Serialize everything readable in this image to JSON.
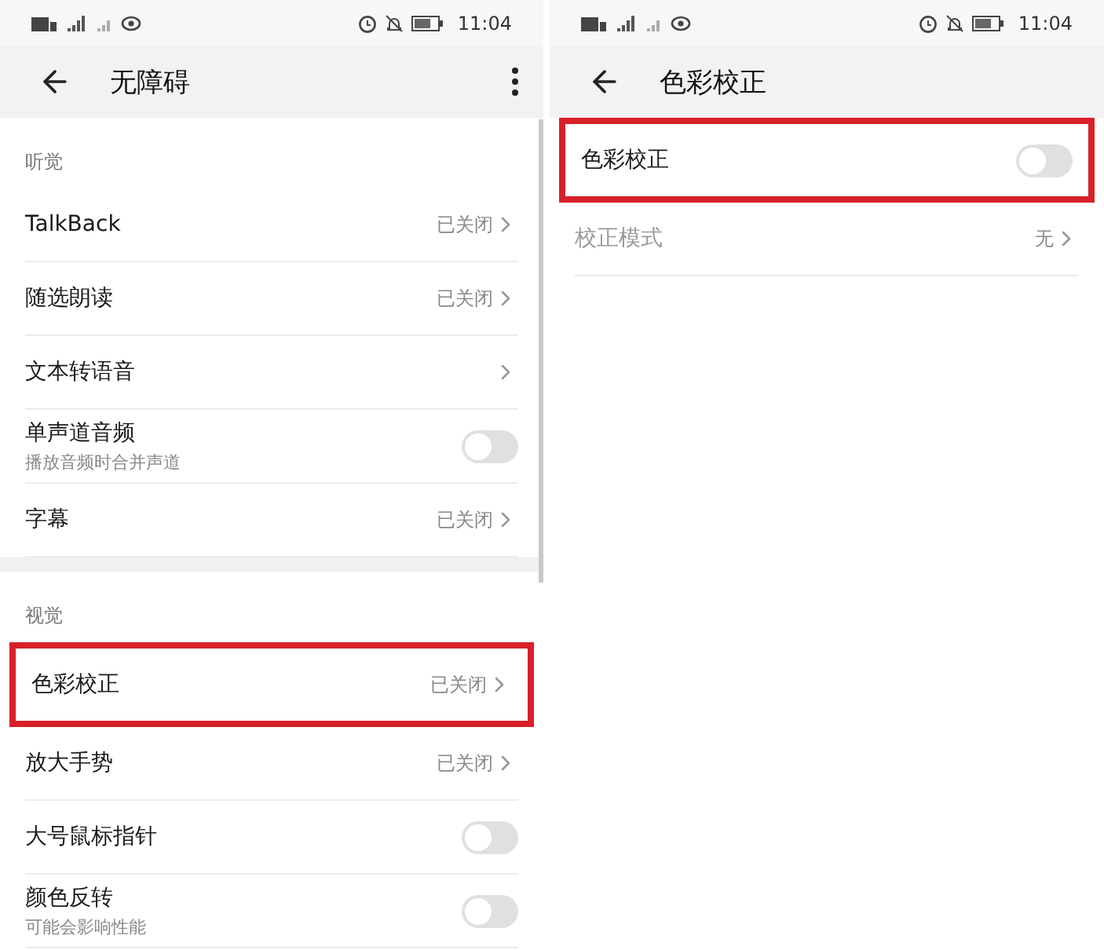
{
  "screens": [
    {
      "status_bar": {
        "time": "11:04"
      },
      "header": {
        "title": "无障碍",
        "menu": true
      },
      "sections": [
        {
          "title": "听觉",
          "items": [
            {
              "kind": "link",
              "label": "TalkBack",
              "value": "已关闭",
              "highlighted": false,
              "disabled": false
            },
            {
              "kind": "link",
              "label": "随选朗读",
              "value": "已关闭",
              "highlighted": false,
              "disabled": false
            },
            {
              "kind": "link",
              "label": "文本转语音",
              "highlighted": false,
              "disabled": false
            },
            {
              "kind": "toggle",
              "label": "单声道音频",
              "subtitle": "播放音频时合并声道",
              "on": false,
              "highlighted": false,
              "disabled": false
            },
            {
              "kind": "link",
              "label": "字幕",
              "value": "已关闭",
              "highlighted": false,
              "disabled": false
            }
          ]
        },
        {
          "title": "视觉",
          "items": [
            {
              "kind": "link",
              "label": "色彩校正",
              "value": "已关闭",
              "highlighted": true,
              "disabled": false
            },
            {
              "kind": "link",
              "label": "放大手势",
              "value": "已关闭",
              "highlighted": false,
              "disabled": false
            },
            {
              "kind": "toggle",
              "label": "大号鼠标指针",
              "on": false,
              "highlighted": false,
              "disabled": false
            },
            {
              "kind": "toggle",
              "label": "颜色反转",
              "subtitle": "可能会影响性能",
              "on": false,
              "highlighted": false,
              "disabled": false
            }
          ]
        }
      ]
    },
    {
      "status_bar": {
        "time": "11:04"
      },
      "header": {
        "title": "色彩校正",
        "menu": false
      },
      "sections": [
        {
          "items": [
            {
              "kind": "toggle",
              "label": "色彩校正",
              "on": false,
              "highlighted": true,
              "disabled": false
            },
            {
              "kind": "link",
              "label": "校正模式",
              "value": "无",
              "highlighted": false,
              "disabled": true
            }
          ]
        }
      ]
    }
  ]
}
